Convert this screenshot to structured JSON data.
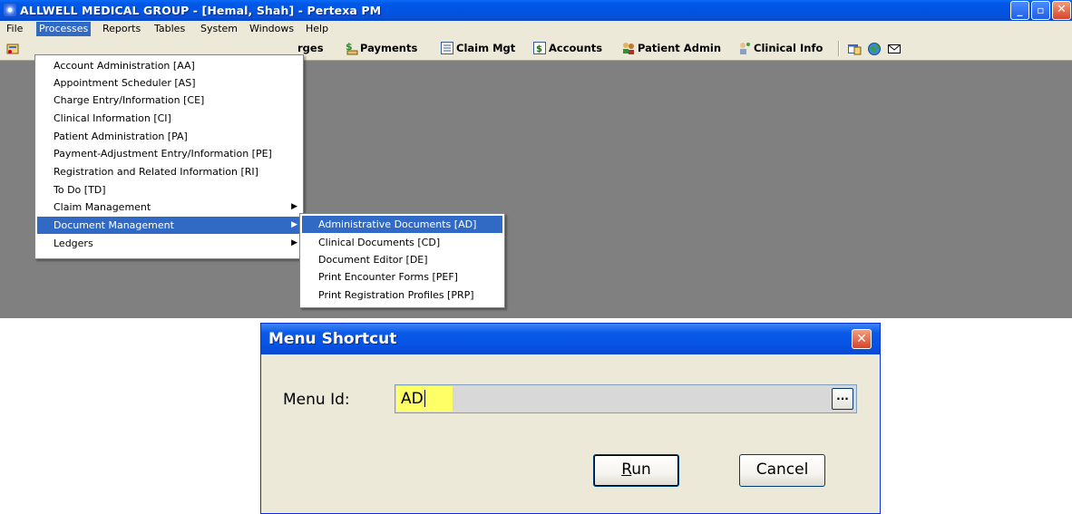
{
  "window": {
    "title": "ALLWELL MEDICAL GROUP - [Hemal, Shah] - Pertexa PM",
    "controls": {
      "minimize": "_",
      "maximize": "▫",
      "close": "✕"
    }
  },
  "menubar": {
    "items": [
      "File",
      "Processes",
      "Reports",
      "Tables",
      "System",
      "Windows",
      "Help"
    ],
    "active": "Processes"
  },
  "toolbar": {
    "items": [
      {
        "label": "rges",
        "icon": "charges-icon"
      },
      {
        "label": "Payments",
        "icon": "payments-icon"
      },
      {
        "label": "Claim Mgt",
        "icon": "claim-mgt-icon"
      },
      {
        "label": "Accounts",
        "icon": "accounts-icon"
      },
      {
        "label": "Patient Admin",
        "icon": "patient-admin-icon"
      },
      {
        "label": "Clinical Info",
        "icon": "clinical-info-icon"
      }
    ],
    "extra_icons": [
      "window-icon",
      "globe-icon",
      "mail-icon"
    ]
  },
  "processes_menu": {
    "items": [
      "Account Administration [AA]",
      "Appointment Scheduler [AS]",
      "Charge Entry/Information [CE]",
      "Clinical Information [CI]",
      "Patient Administration [PA]",
      "Payment-Adjustment Entry/Information [PE]",
      "Registration and Related Information [RI]",
      "To Do [TD]",
      "Claim Management",
      "Document Management",
      "Ledgers"
    ],
    "submenu_arrows": [
      "Claim Management",
      "Document Management",
      "Ledgers"
    ],
    "selected": "Document Management"
  },
  "document_management_submenu": {
    "items": [
      "Administrative Documents [AD]",
      "Clinical Documents [CD]",
      "Document Editor [DE]",
      "Print Encounter Forms [PEF]",
      "Print Registration Profiles [PRP]"
    ],
    "selected": "Administrative Documents [AD]"
  },
  "dialog": {
    "title": "Menu Shortcut",
    "label": "Menu Id:",
    "input_value": "AD",
    "browse_label": "...",
    "run_label": "Run",
    "cancel_label": "Cancel"
  },
  "colors": {
    "title_blue": "#0054e3",
    "menu_highlight": "#316ac5",
    "workspace_gray": "#808080",
    "input_highlight": "#ffff66"
  }
}
